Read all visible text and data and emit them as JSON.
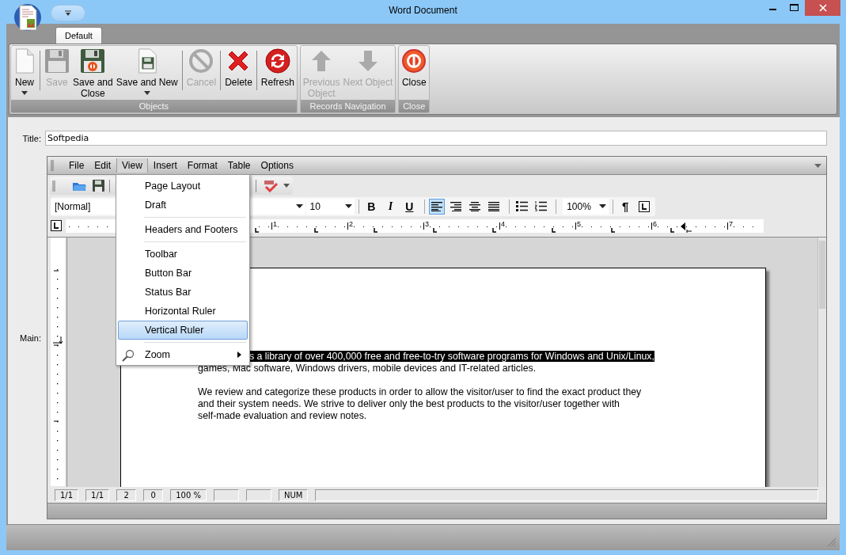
{
  "window": {
    "title": "Word Document"
  },
  "ribbon": {
    "tabs": [
      {
        "label": "Default",
        "selected": true
      }
    ],
    "groups": [
      {
        "label": "Objects",
        "items": [
          {
            "kind": "new",
            "label": "New",
            "disabled": false,
            "dropdown": true
          },
          {
            "kind": "separator"
          },
          {
            "kind": "save",
            "label": "Save",
            "disabled": true,
            "dropdown": false
          },
          {
            "kind": "save_close",
            "label": "Save and\nClose",
            "disabled": false,
            "dropdown": false
          },
          {
            "kind": "save_new",
            "label": "Save and New",
            "disabled": false,
            "dropdown": true
          },
          {
            "kind": "separator"
          },
          {
            "kind": "cancel",
            "label": "Cancel",
            "disabled": true,
            "dropdown": false
          },
          {
            "kind": "separator"
          },
          {
            "kind": "delete",
            "label": "Delete",
            "disabled": false,
            "dropdown": false
          },
          {
            "kind": "separator"
          },
          {
            "kind": "refresh",
            "label": "Refresh",
            "disabled": false,
            "dropdown": false
          }
        ]
      },
      {
        "label": "Records Navigation",
        "items": [
          {
            "kind": "up",
            "label": "Previous\nObject",
            "disabled": true,
            "dropdown": false
          },
          {
            "kind": "down",
            "label": "Next Object",
            "disabled": true,
            "dropdown": false
          }
        ]
      },
      {
        "label": "Close",
        "items": [
          {
            "kind": "close",
            "label": "Close",
            "disabled": false,
            "dropdown": false
          }
        ]
      }
    ]
  },
  "form": {
    "title_label": "Title:",
    "title_value": "Softpedia",
    "main_label": "Main:"
  },
  "editor": {
    "menu": [
      {
        "label": "File",
        "selected": false
      },
      {
        "label": "Edit",
        "selected": false
      },
      {
        "label": "View",
        "selected": true
      },
      {
        "label": "Insert",
        "selected": false
      },
      {
        "label": "Format",
        "selected": false
      },
      {
        "label": "Table",
        "selected": false
      },
      {
        "label": "Options",
        "selected": false
      }
    ],
    "format_bar": {
      "style": "[Normal]",
      "size": "10",
      "zoom": "100%",
      "buttons": [
        {
          "kind": "separator"
        },
        {
          "kind": "bold",
          "label": "B",
          "selected": false
        },
        {
          "kind": "italic",
          "label": "I",
          "selected": false
        },
        {
          "kind": "underline",
          "label": "U",
          "selected": false
        },
        {
          "kind": "separator"
        },
        {
          "kind": "align_left",
          "selected": true
        },
        {
          "kind": "align_right",
          "selected": false
        },
        {
          "kind": "align_center",
          "selected": false
        },
        {
          "kind": "justify",
          "selected": false
        },
        {
          "kind": "separator"
        },
        {
          "kind": "bullets",
          "selected": false
        },
        {
          "kind": "numbering",
          "selected": false
        }
      ],
      "tail": [
        {
          "kind": "pilcrow",
          "label": "¶",
          "selected": false
        },
        {
          "kind": "tab",
          "selected": false
        }
      ]
    },
    "ruler": {
      "numbers": [
        "1",
        "2",
        "3",
        "4",
        "5",
        "6",
        "7"
      ]
    },
    "document": {
      "paragraphs": [
        {
          "lines": [
            {
              "text": "s a library of over 400,000 free and free-to-try software programs for Windows and Unix/Linux,",
              "selected": true
            },
            {
              "text": "games, Mac software, Windows drivers, mobile devices and IT-related articles.",
              "selected": false
            }
          ]
        },
        {
          "lines": [
            {
              "text": "We review and categorize these products in order to allow the visitor/user to find the exact product they",
              "selected": false
            },
            {
              "text": "and their system needs. We strive to deliver only the best products to the visitor/user together with",
              "selected": false
            },
            {
              "text": "self-made evaluation and review notes.",
              "selected": false
            }
          ]
        }
      ]
    },
    "status_bar": [
      {
        "kind": "text",
        "text": "1/1"
      },
      {
        "kind": "text",
        "text": "1/1"
      },
      {
        "kind": "text",
        "text": "2"
      },
      {
        "kind": "text",
        "text": "0"
      },
      {
        "kind": "text",
        "text": "100 %"
      },
      {
        "kind": "blank"
      },
      {
        "kind": "blank"
      },
      {
        "kind": "text",
        "text": "NUM"
      },
      {
        "kind": "wide"
      }
    ]
  },
  "view_menu": {
    "items": [
      {
        "kind": "item",
        "label": "Page Layout",
        "selected": false
      },
      {
        "kind": "item",
        "label": "Draft",
        "selected": false
      },
      {
        "kind": "separator"
      },
      {
        "kind": "item",
        "label": "Headers and Footers",
        "selected": false
      },
      {
        "kind": "separator"
      },
      {
        "kind": "item",
        "label": "Toolbar",
        "selected": false
      },
      {
        "kind": "item",
        "label": "Button Bar",
        "selected": false
      },
      {
        "kind": "item",
        "label": "Status Bar",
        "selected": false
      },
      {
        "kind": "item",
        "label": "Horizontal Ruler",
        "selected": false
      },
      {
        "kind": "item",
        "label": "Vertical Ruler",
        "selected": true
      },
      {
        "kind": "separator"
      },
      {
        "kind": "submenu",
        "label": "Zoom",
        "selected": false
      }
    ]
  }
}
